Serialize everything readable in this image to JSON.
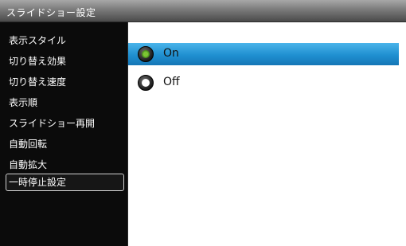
{
  "window": {
    "title": "スライドショー設定"
  },
  "sidebar": {
    "items": [
      {
        "label": "表示スタイル",
        "selected": false
      },
      {
        "label": "切り替え効果",
        "selected": false
      },
      {
        "label": "切り替え速度",
        "selected": false
      },
      {
        "label": "表示順",
        "selected": false
      },
      {
        "label": "スライドショー再開",
        "selected": false
      },
      {
        "label": "自動回転",
        "selected": false
      },
      {
        "label": "自動拡大",
        "selected": false
      },
      {
        "label": "一時停止設定",
        "selected": true
      }
    ]
  },
  "options": {
    "items": [
      {
        "label": "On",
        "checked": true,
        "highlighted": true
      },
      {
        "label": "Off",
        "checked": false,
        "highlighted": false
      }
    ]
  },
  "colors": {
    "highlight": "#1f8fd0",
    "radio_checked": "#7cc62c",
    "title_bar": "#7a7a7a",
    "sidebar_background": "#0b0b0b"
  }
}
